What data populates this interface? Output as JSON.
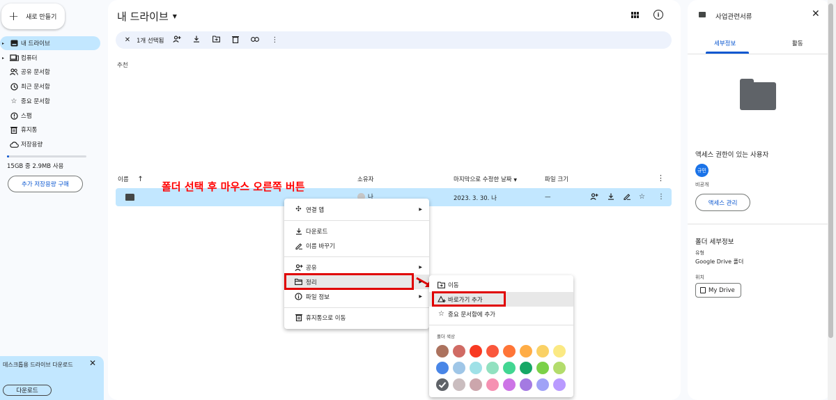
{
  "sidebar": {
    "new_label": "새로 만들기",
    "items": [
      {
        "label": "내 드라이브",
        "icon": "my-drive-icon",
        "caret": "▸"
      },
      {
        "label": "컴퓨터",
        "icon": "computer-icon",
        "caret": "▸"
      },
      {
        "label": "공유 문서함",
        "icon": "shared-icon",
        "caret": ""
      },
      {
        "label": "최근 문서함",
        "icon": "recent-icon",
        "caret": ""
      },
      {
        "label": "중요 문서함",
        "icon": "star-icon",
        "caret": ""
      },
      {
        "label": "스팸",
        "icon": "spam-icon",
        "caret": ""
      },
      {
        "label": "휴지통",
        "icon": "trash-icon",
        "caret": ""
      },
      {
        "label": "저장용량",
        "icon": "cloud-icon",
        "caret": ""
      }
    ],
    "storage_text": "15GB 중 2.9MB 사용",
    "buy_storage": "추가 저장용량 구매",
    "promo_text": "데스크톱용 드라이브 다운로드",
    "promo_button": "다운로드"
  },
  "header": {
    "title": "내 드라이브"
  },
  "selection_bar": {
    "count_label": "1개 선택됨"
  },
  "main": {
    "recommended": "추천",
    "columns": {
      "name": "이름",
      "owner": "소유자",
      "modified": "마지막으로 수정한 날짜",
      "size": "파일 크기"
    },
    "row": {
      "owner": "나",
      "modified": "2023. 3. 30. 나",
      "size": "—"
    }
  },
  "annotation": "폴더 선택 후 마우스 오른쪽 버튼",
  "context_menu": {
    "open_with": "연결 앱",
    "download": "다운로드",
    "rename": "이름 바꾸기",
    "share": "공유",
    "organize": "정리",
    "file_info": "파일 정보",
    "move_to_trash": "휴지통으로 이동"
  },
  "organize_submenu": {
    "move": "이동",
    "add_shortcut": "바로가기 추가",
    "add_to_starred": "중요 문서함에 추가",
    "folder_color_label": "폴더 색상",
    "colors": [
      "#ac725e",
      "#d06b64",
      "#f83a22",
      "#fa573c",
      "#ff7537",
      "#ffad46",
      "#fad165",
      "#fbe983",
      "#4986e7",
      "#9fc6e7",
      "#9fe1e7",
      "#92e1c0",
      "#42d692",
      "#16a765",
      "#7bd148",
      "#b3dc6c",
      "#5f6368",
      "#cabdbf",
      "#cca6ac",
      "#f691b2",
      "#cd74e6",
      "#a47ae2",
      "#a0a3f7",
      "#b99aff"
    ]
  },
  "details_panel": {
    "title": "사업관련서류",
    "tab_details": "세부정보",
    "tab_activity": "활동",
    "access_title": "액세스 권한이 있는 사용자",
    "avatar_text": "규민",
    "access_private": "비공개",
    "manage_access": "액세스 관리",
    "folder_details_title": "폴더 세부정보",
    "type_label": "유형",
    "type_value": "Google Drive 폴더",
    "location_label": "위치",
    "location_value": "My Drive"
  },
  "colors": {
    "accent": "#0b57d0",
    "selected": "#c2e7ff",
    "highlight_box": "#e00000"
  }
}
